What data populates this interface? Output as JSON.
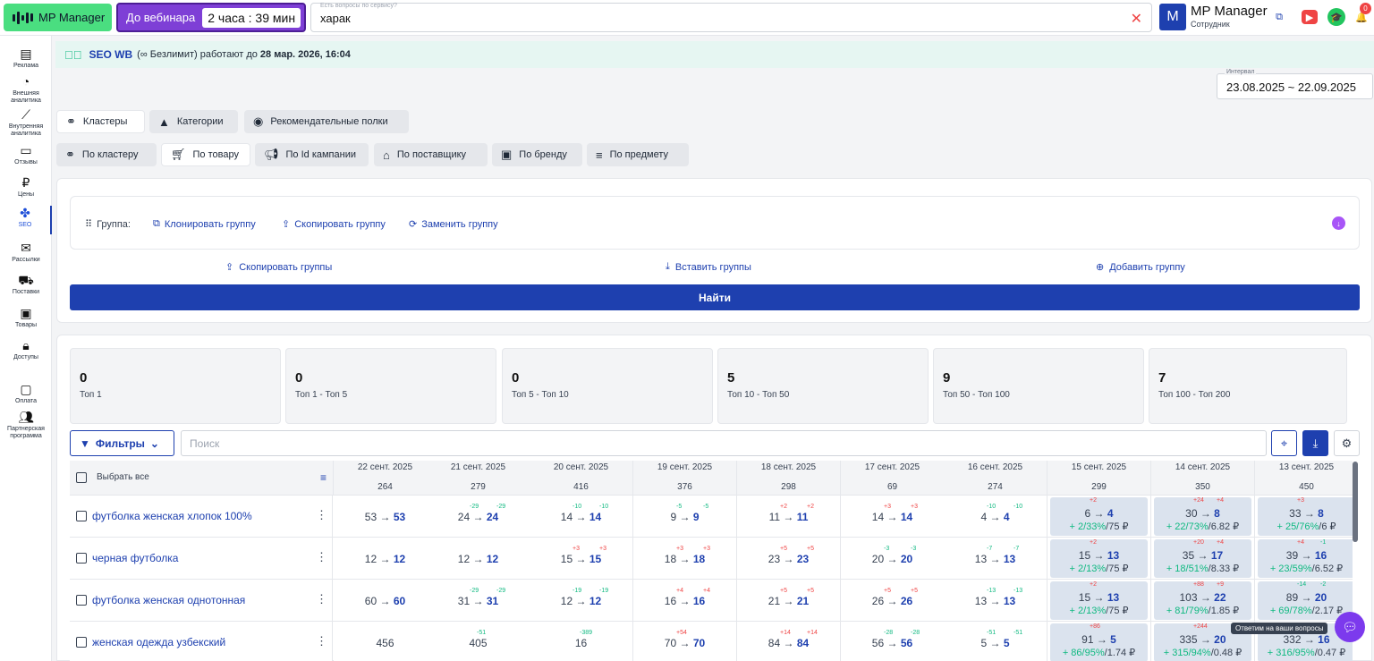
{
  "topbar": {
    "logo_label": "MP Manager",
    "webinar_label": "До вебинара",
    "webinar_timer": "2 часа : 39 мин",
    "search_label": "Есть вопросы по сервису?",
    "search_value": "харак",
    "account_initial": "M",
    "account_name": "MP Manager",
    "account_role": "Сотрудник",
    "notif_count": "0"
  },
  "sidebar": [
    {
      "label": "Реклама",
      "icon": "ads-icon"
    },
    {
      "label": "Внешняя аналитика",
      "icon": "external-analytics-icon"
    },
    {
      "label": "Внутренняя аналитика",
      "icon": "internal-analytics-icon"
    },
    {
      "label": "Отзывы",
      "icon": "reviews-icon"
    },
    {
      "label": "Цены",
      "icon": "ruble-icon"
    },
    {
      "label": "SEO",
      "icon": "seo-icon"
    },
    {
      "label": "Рассылки",
      "icon": "mail-icon"
    },
    {
      "label": "Поставки",
      "icon": "truck-icon"
    },
    {
      "label": "Товары",
      "icon": "box-icon"
    },
    {
      "label": "Доступы",
      "icon": "lock-icon"
    },
    {
      "label": "Оплата",
      "icon": "wallet-icon"
    },
    {
      "label": "Партнерская программа",
      "icon": "partners-icon"
    }
  ],
  "notice": {
    "title": "SEO WB",
    "text": "(∞ Безлимит) работают до",
    "until": "28 мар. 2026, 16:04"
  },
  "interval": {
    "label": "Интервал",
    "value": "23.08.2025 ~ 22.09.2025"
  },
  "tabs_main": [
    "Кластеры",
    "Категории",
    "Рекомендательные полки"
  ],
  "tabs_sub": [
    "По кластеру",
    "По товару",
    "По Id кампании",
    "По поставщику",
    "По бренду",
    "По предмету"
  ],
  "group": {
    "label": "Группа:",
    "clone": "Клонировать группу",
    "copy": "Скопировать группу",
    "replace": "Заменить группу"
  },
  "actions": {
    "copy_groups": "Скопировать группы",
    "paste_groups": "Вставить группы",
    "add_group": "Добавить группу"
  },
  "find_label": "Найти",
  "stats": [
    {
      "value": "0",
      "label": "Топ 1"
    },
    {
      "value": "0",
      "label": "Топ 1 - Топ 5"
    },
    {
      "value": "0",
      "label": "Топ 5 - Топ 10"
    },
    {
      "value": "5",
      "label": "Топ 10 - Топ 50"
    },
    {
      "value": "9",
      "label": "Топ 50 - Топ 100"
    },
    {
      "value": "7",
      "label": "Топ 100 - Топ 200"
    }
  ],
  "filters_label": "Фильтры",
  "table_search_placeholder": "Поиск",
  "select_all": "Выбрать все",
  "columns": [
    {
      "date": "22 сент. 2025",
      "total": "264"
    },
    {
      "date": "21 сент. 2025",
      "total": "279"
    },
    {
      "date": "20 сент. 2025",
      "total": "416"
    },
    {
      "date": "19 сент. 2025",
      "total": "376"
    },
    {
      "date": "18 сент. 2025",
      "total": "298"
    },
    {
      "date": "17 сент. 2025",
      "total": "69"
    },
    {
      "date": "16 сент. 2025",
      "total": "274"
    },
    {
      "date": "15 сент. 2025",
      "total": "299"
    },
    {
      "date": "14 сент. 2025",
      "total": "350"
    },
    {
      "date": "13 сент. 2025",
      "total": "450"
    }
  ],
  "rows": [
    {
      "keyword": "футболка женская хлопок 100%",
      "cells": [
        {
          "a": "53",
          "b": "53",
          "s1": "",
          "s2": ""
        },
        {
          "a": "24",
          "b": "24",
          "s1": "-29",
          "s2": "-29"
        },
        {
          "a": "14",
          "b": "14",
          "s1": "-10",
          "s2": "-10"
        },
        {
          "a": "9",
          "b": "9",
          "s1": "-5",
          "s2": "-5"
        },
        {
          "a": "11",
          "b": "11",
          "s1": "+2",
          "s2": "+2"
        },
        {
          "a": "14",
          "b": "14",
          "s1": "+3",
          "s2": "+3"
        },
        {
          "a": "4",
          "b": "4",
          "s1": "-10",
          "s2": "-10"
        },
        {
          "a": "6",
          "b": "4",
          "s1": "+2",
          "s2": "",
          "plus": "+ 2/",
          "pct": "33%",
          "rest": "/75 ₽"
        },
        {
          "a": "30",
          "b": "8",
          "s1": "+24",
          "s2": "+4",
          "plus": "+ 22/",
          "pct": "73%",
          "rest": "/6.82 ₽"
        },
        {
          "a": "33",
          "b": "8",
          "s1": "+3",
          "s2": "",
          "plus": "+ 25/",
          "pct": "76%",
          "rest": "/6 ₽"
        }
      ]
    },
    {
      "keyword": "черная футболка",
      "cells": [
        {
          "a": "12",
          "b": "12",
          "s1": "",
          "s2": ""
        },
        {
          "a": "12",
          "b": "12",
          "s1": "",
          "s2": ""
        },
        {
          "a": "15",
          "b": "15",
          "s1": "+3",
          "s2": "+3"
        },
        {
          "a": "18",
          "b": "18",
          "s1": "+3",
          "s2": "+3"
        },
        {
          "a": "23",
          "b": "23",
          "s1": "+5",
          "s2": "+5"
        },
        {
          "a": "20",
          "b": "20",
          "s1": "-3",
          "s2": "-3"
        },
        {
          "a": "13",
          "b": "13",
          "s1": "-7",
          "s2": "-7"
        },
        {
          "a": "15",
          "b": "13",
          "s1": "+2",
          "s2": "",
          "plus": "+ 2/",
          "pct": "13%",
          "rest": "/75 ₽"
        },
        {
          "a": "35",
          "b": "17",
          "s1": "+20",
          "s2": "+4",
          "plus": "+ 18/",
          "pct": "51%",
          "rest": "/8.33 ₽"
        },
        {
          "a": "39",
          "b": "16",
          "s1": "+4",
          "s2": "-1",
          "plus": "+ 23/",
          "pct": "59%",
          "rest": "/6.52 ₽"
        }
      ]
    },
    {
      "keyword": "футболка женская однотонная",
      "cells": [
        {
          "a": "60",
          "b": "60",
          "s1": "",
          "s2": ""
        },
        {
          "a": "31",
          "b": "31",
          "s1": "-29",
          "s2": "-29"
        },
        {
          "a": "12",
          "b": "12",
          "s1": "-19",
          "s2": "-19"
        },
        {
          "a": "16",
          "b": "16",
          "s1": "+4",
          "s2": "+4"
        },
        {
          "a": "21",
          "b": "21",
          "s1": "+5",
          "s2": "+5"
        },
        {
          "a": "26",
          "b": "26",
          "s1": "+5",
          "s2": "+5"
        },
        {
          "a": "13",
          "b": "13",
          "s1": "-13",
          "s2": "-13"
        },
        {
          "a": "15",
          "b": "13",
          "s1": "+2",
          "s2": "",
          "plus": "+ 2/",
          "pct": "13%",
          "rest": "/75 ₽"
        },
        {
          "a": "103",
          "b": "22",
          "s1": "+88",
          "s2": "+9",
          "plus": "+ 81/",
          "pct": "79%",
          "rest": "/1.85 ₽"
        },
        {
          "a": "89",
          "b": "20",
          "s1": "-14",
          "s2": "-2",
          "plus": "+ 69/",
          "pct": "78%",
          "rest": "/2.17 ₽"
        }
      ]
    },
    {
      "keyword": "женская одежда узбекский",
      "cells": [
        {
          "a": "456",
          "b": "",
          "s1": "",
          "s2": ""
        },
        {
          "a": "405",
          "b": "",
          "s1": "-51",
          "s2": ""
        },
        {
          "a": "16",
          "b": "",
          "s1": "-389",
          "s2": ""
        },
        {
          "a": "70",
          "b": "70",
          "s1": "+54",
          "s2": ""
        },
        {
          "a": "84",
          "b": "84",
          "s1": "+14",
          "s2": "+14"
        },
        {
          "a": "56",
          "b": "56",
          "s1": "-28",
          "s2": "-28"
        },
        {
          "a": "5",
          "b": "5",
          "s1": "-51",
          "s2": "-51"
        },
        {
          "a": "91",
          "b": "5",
          "s1": "+86",
          "s2": "",
          "plus": "+ 86/",
          "pct": "95%",
          "rest": "/1.74 ₽"
        },
        {
          "a": "335",
          "b": "20",
          "s1": "+244",
          "s2": "",
          "plus": "+ 315/",
          "pct": "94%",
          "rest": "/0.48 ₽"
        },
        {
          "a": "332",
          "b": "16",
          "s1": "",
          "s2": "",
          "plus": "+ 316/",
          "pct": "95%",
          "rest": "/0.47 ₽"
        }
      ]
    }
  ],
  "chat_tooltip": "Ответим на ваши вопросы",
  "colors": {
    "accent": "#1e40af",
    "success": "#10b981",
    "danger": "#ef4444",
    "webinar": "#7e3fd6",
    "logo": "#4ade80"
  }
}
